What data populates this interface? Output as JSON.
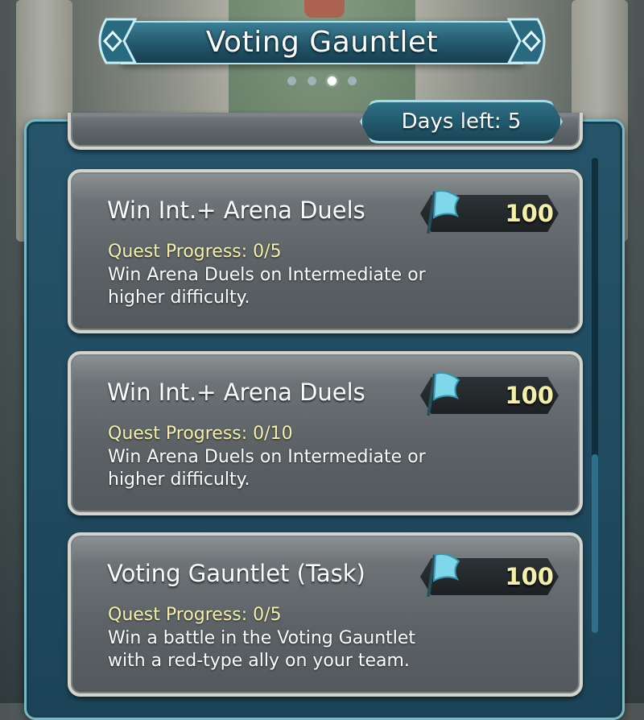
{
  "header": {
    "title": "Voting Gauntlet",
    "page_dots": {
      "count": 4,
      "active_index": 2
    }
  },
  "status": {
    "days_left_label": "Days left: 5"
  },
  "quests": [
    {
      "title": "Win Int.+ Arena Duels",
      "progress": "Quest Progress: 0/5",
      "description": "Win Arena Duels on Intermediate or higher difficulty.",
      "reward_icon": "flag-icon",
      "reward_value": "100"
    },
    {
      "title": "Win Int.+ Arena Duels",
      "progress": "Quest Progress: 0/10",
      "description": "Win Arena Duels on Intermediate or higher difficulty.",
      "reward_icon": "flag-icon",
      "reward_value": "100"
    },
    {
      "title": "Voting Gauntlet (Task)",
      "progress": "Quest Progress: 0/5",
      "description": "Win a battle in the Voting Gauntlet with a red-type ally on your team.",
      "reward_icon": "flag-icon",
      "reward_value": "100"
    }
  ],
  "colors": {
    "panel": "#1c4357",
    "accent_border": "#a9dbe6",
    "progress_text": "#f4f0a8",
    "card": "#5b6164"
  }
}
